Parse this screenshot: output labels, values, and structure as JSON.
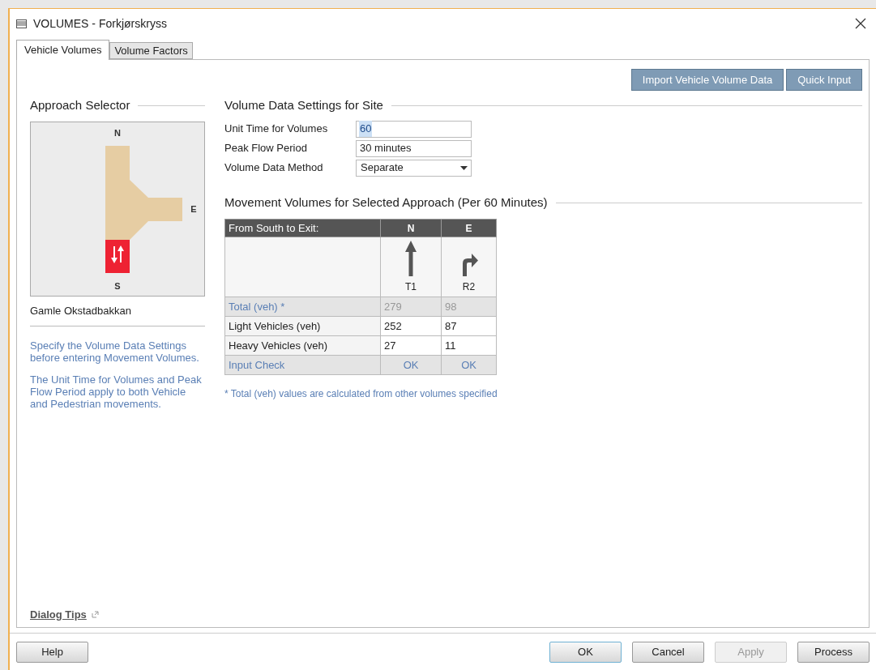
{
  "window": {
    "title": "VOLUMES - Forkjørskryss"
  },
  "tabs": [
    {
      "label": "Vehicle Volumes",
      "selected": true
    },
    {
      "label": "Volume Factors",
      "selected": false
    }
  ],
  "toolbar_buttons": [
    "Import Vehicle Volume Data",
    "Quick Input"
  ],
  "approach_selector": {
    "title": "Approach Selector",
    "legs": [
      {
        "label": "N",
        "selected": false
      },
      {
        "label": "E",
        "selected": false
      },
      {
        "label": "S",
        "selected": true
      }
    ],
    "approach_name": "Gamle Okstadbakkan"
  },
  "help_texts": [
    "Specify the Volume Data Settings before entering Movement Volumes.",
    "The Unit Time for Volumes and Peak Flow Period apply to both Vehicle and Pedestrian movements."
  ],
  "settings": {
    "title": "Volume Data Settings for Site",
    "fields": [
      {
        "label": "Unit Time for Volumes",
        "value": "60",
        "kind": "text",
        "text_selected": true
      },
      {
        "label": "Peak Flow Period",
        "value": "30 minutes",
        "kind": "text",
        "text_selected": false
      },
      {
        "label": "Volume Data Method",
        "value": "Separate",
        "kind": "dropdown",
        "text_selected": false
      }
    ]
  },
  "movements": {
    "title": "Movement Volumes for Selected Approach (Per 60 Minutes)",
    "corner": "From South to Exit:",
    "columns": [
      {
        "exit": "N",
        "code": "T1",
        "kind": "through"
      },
      {
        "exit": "E",
        "code": "R2",
        "kind": "right"
      }
    ],
    "rows": [
      {
        "label": "Total (veh) *",
        "kind": "computed",
        "values": [
          "279",
          "98"
        ]
      },
      {
        "label": "Light Vehicles (veh)",
        "kind": "input",
        "values": [
          "252",
          "87"
        ]
      },
      {
        "label": "Heavy Vehicles (veh)",
        "kind": "input",
        "values": [
          "27",
          "11"
        ]
      },
      {
        "label": "Input Check",
        "kind": "check",
        "values": [
          "OK",
          "OK"
        ]
      }
    ],
    "footnote": "* Total (veh) values are calculated from other volumes specified"
  },
  "dialog_tips": "Dialog Tips",
  "footer_buttons": [
    {
      "label": "Help",
      "disabled": false,
      "default": false
    },
    {
      "label": "OK",
      "disabled": false,
      "default": true
    },
    {
      "label": "Cancel",
      "disabled": false,
      "default": false
    },
    {
      "label": "Apply",
      "disabled": true,
      "default": false
    },
    {
      "label": "Process",
      "disabled": false,
      "default": false
    }
  ]
}
